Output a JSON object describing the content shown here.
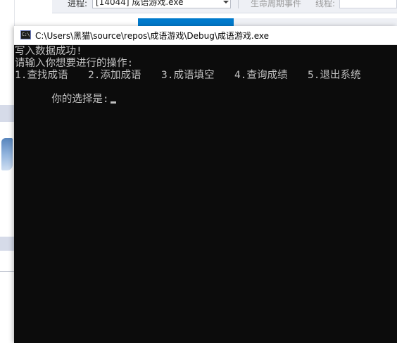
{
  "background_ide": {
    "process_label": "进程:",
    "process_value": "[14044] 成语游戏.exe",
    "lifecycle_label": "生命周期事件",
    "thread_label": "线程:"
  },
  "console": {
    "title": "C:\\Users\\黑猫\\source\\repos\\成语游戏\\Debug\\成语游戏.exe",
    "icon_text": "C:\\",
    "lines": {
      "write_success": "写入数据成功!",
      "prompt": "请输入你想要进行的操作:",
      "menu": [
        "1.查找成语",
        "2.添加成语",
        "3.成语填空",
        "4.查询成绩",
        "5.退出系统"
      ],
      "choice_prompt": "你的选择是:"
    }
  },
  "colors": {
    "console_background": "#0c0c0c",
    "console_text": "#c0c0c0",
    "ide_accent": "#007acc"
  }
}
